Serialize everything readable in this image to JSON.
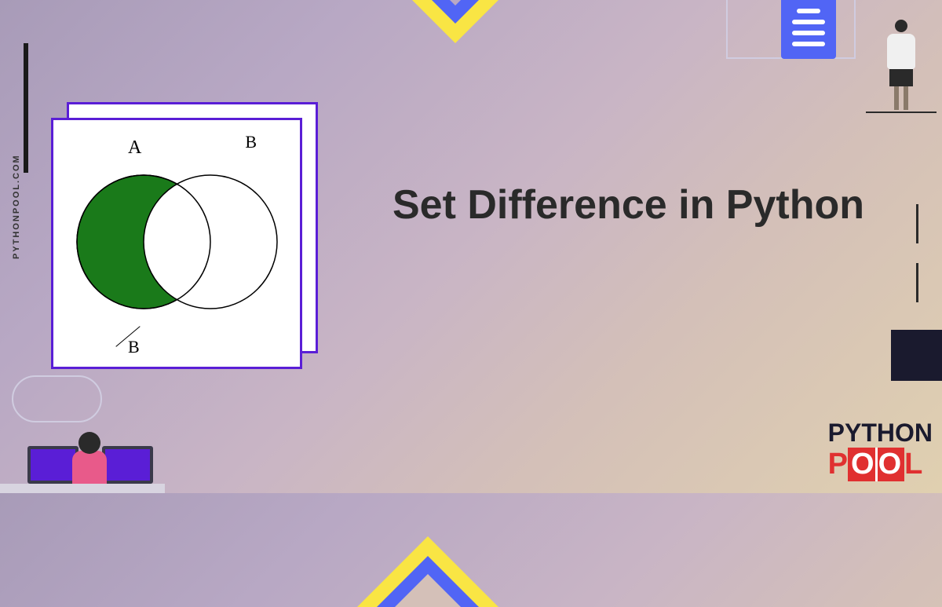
{
  "heading": "Set Difference in Python",
  "vertical_text": "PYTHONPOOL.COM",
  "venn": {
    "label_a": "A",
    "label_b": "B",
    "label_b2": "B"
  },
  "logo": {
    "top_line": "PYTHON",
    "bottom_p": "P",
    "bottom_o1": "O",
    "bottom_o2": "O",
    "bottom_l": "L"
  }
}
